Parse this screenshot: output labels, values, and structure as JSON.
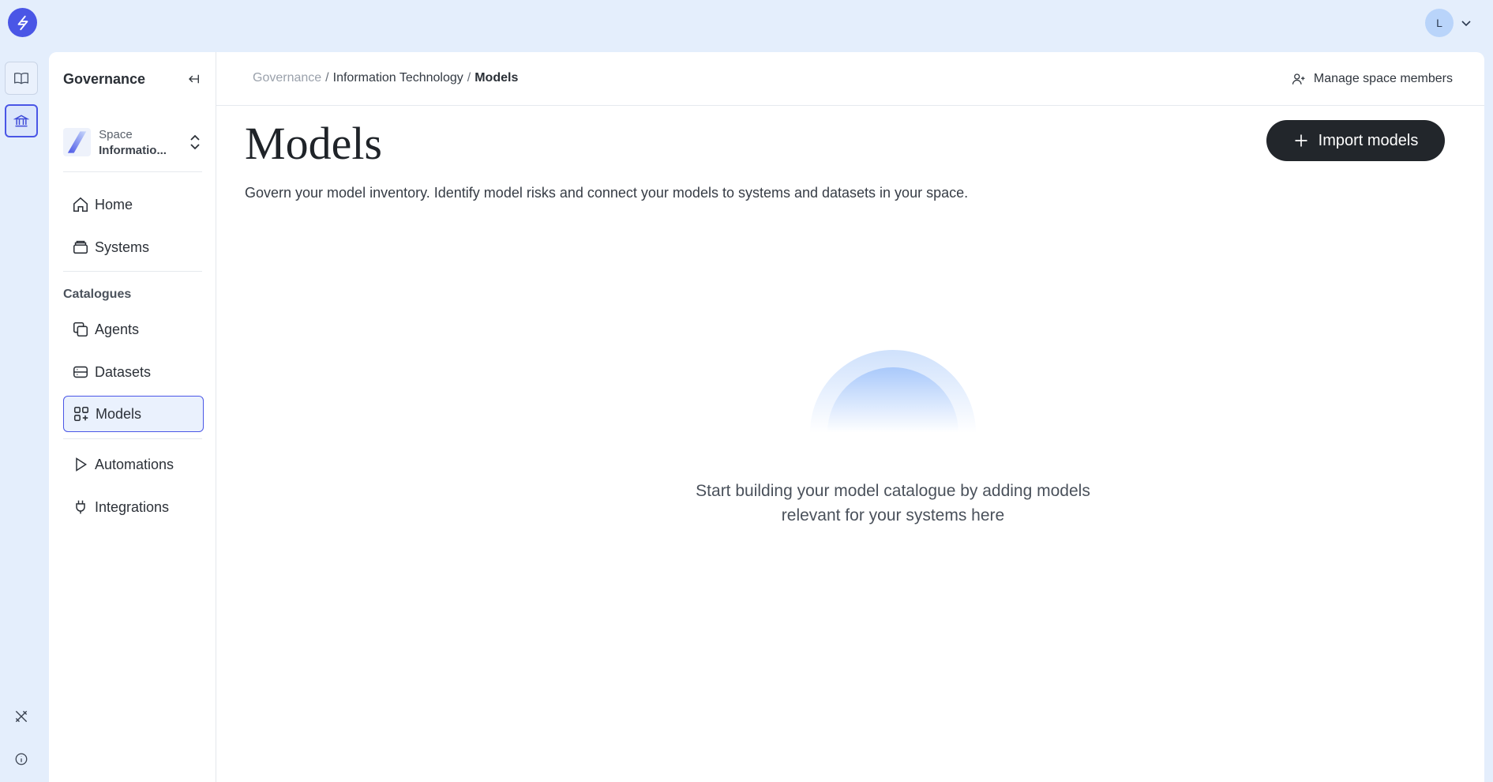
{
  "app": {
    "logo_icon": "lightning-logo-icon",
    "accent": "#4a56e6"
  },
  "user": {
    "avatar_initial": "L"
  },
  "rail": {
    "items": [
      "book-icon",
      "bank-icon",
      "tools-icon",
      "info-icon"
    ]
  },
  "sidebar": {
    "title": "Governance",
    "space": {
      "label": "Space",
      "name": "Informatio..."
    },
    "top_items": [
      {
        "label": "Home",
        "icon": "home-icon"
      },
      {
        "label": "Systems",
        "icon": "systems-icon"
      }
    ],
    "section_label": "Catalogues",
    "catalogue_items": [
      {
        "label": "Agents",
        "icon": "agents-icon"
      },
      {
        "label": "Datasets",
        "icon": "datasets-icon"
      },
      {
        "label": "Models",
        "icon": "models-icon",
        "active": true
      }
    ],
    "bottom_items": [
      {
        "label": "Automations",
        "icon": "play-icon"
      },
      {
        "label": "Integrations",
        "icon": "plug-icon"
      }
    ]
  },
  "breadcrumb": {
    "root": "Governance",
    "middle": "Information Technology",
    "current": "Models",
    "separator": "/"
  },
  "header": {
    "manage_label": "Manage space members"
  },
  "main": {
    "title": "Models",
    "import_label": "Import models",
    "subtitle": "Govern your model inventory. Identify model risks and connect your models to systems and datasets in your space.",
    "empty_line1": "Start building your model catalogue by adding models",
    "empty_line2": "relevant for your systems here"
  }
}
